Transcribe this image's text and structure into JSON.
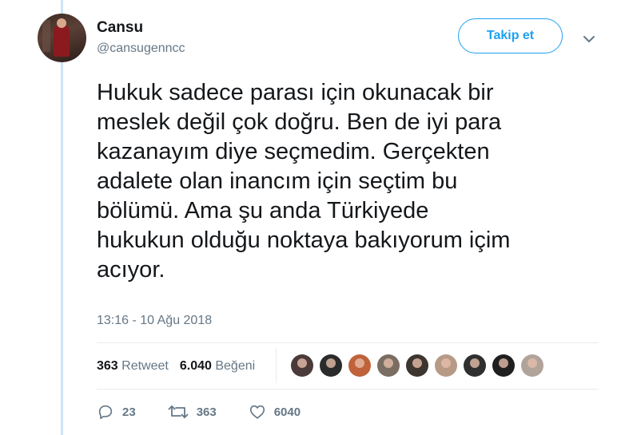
{
  "user": {
    "name": "Cansu",
    "handle": "@cansugenncc"
  },
  "follow_button": {
    "label": "Takip et"
  },
  "tweet": {
    "text": "Hukuk sadece parası için okunacak bir\nmeslek değil çok doğru. Ben de iyi para\nkazanayım diye seçmedim. Gerçekten\nadalete olan inancım için seçtim bu\nbölümü. Ama şu anda Türkiyede\nhukukun olduğu noktaya bakıyorum içim\nacıyor.",
    "timestamp": "13:16 - 10 Ağu 2018"
  },
  "stats": {
    "retweet_count": "363",
    "retweet_label": "Retweet",
    "like_count": "6.040",
    "like_label": "Beğeni"
  },
  "actions": {
    "reply_count": "23",
    "retweet_count": "363",
    "like_count": "6040"
  },
  "colors": {
    "accent": "#1da1f2",
    "muted": "#657786",
    "thread_line": "#cce6f7",
    "liker_colors": [
      "#4a3a3a",
      "#2b2b2b",
      "#c0623a",
      "#7a6e62",
      "#3d3530",
      "#b79a86",
      "#2f2f2f",
      "#1f1f1f",
      "#b0a39a"
    ]
  },
  "icons": {
    "menu": "chevron-down-icon",
    "reply": "reply-icon",
    "retweet": "retweet-icon",
    "like": "heart-icon"
  }
}
